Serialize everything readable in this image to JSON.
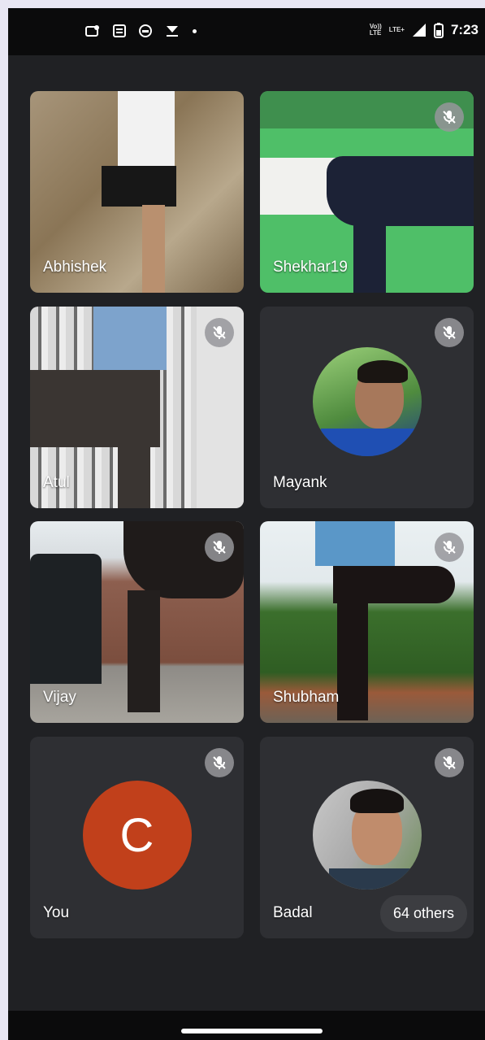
{
  "status_bar": {
    "time": "7:23",
    "volte_label": "Vo))\nLTE",
    "lte_label": "LTE+",
    "left_icons": [
      "cast-icon",
      "news-icon",
      "media-icon",
      "download-icon",
      "dot-icon"
    ],
    "right_icons": [
      "volte-icon",
      "lte-signal-icon",
      "signal-icon",
      "battery-icon"
    ]
  },
  "participants": [
    {
      "name": "Abhishek",
      "muted": false,
      "view": "video"
    },
    {
      "name": "Shekhar19",
      "muted": true,
      "view": "video"
    },
    {
      "name": "Atul",
      "muted": true,
      "view": "video"
    },
    {
      "name": "Mayank",
      "muted": true,
      "view": "avatar-photo"
    },
    {
      "name": "Vijay",
      "muted": true,
      "view": "video"
    },
    {
      "name": "Shubham",
      "muted": true,
      "view": "video"
    },
    {
      "name": "You",
      "muted": true,
      "view": "avatar-letter",
      "initial": "C",
      "color": "#c1401b"
    },
    {
      "name": "Badal",
      "muted": true,
      "view": "avatar-photo"
    }
  ],
  "others_label": "64 others",
  "colors": {
    "background": "#202124",
    "tile": "#2e2f33",
    "mute_badge": "#96969b",
    "frame": "#e8e6f3"
  }
}
